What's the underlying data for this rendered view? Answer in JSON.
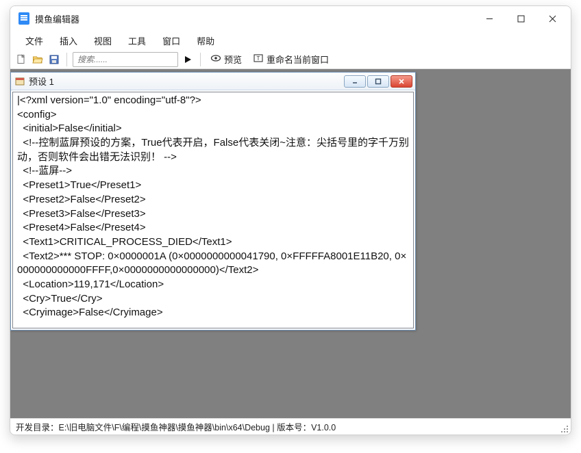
{
  "window": {
    "title": "摸鱼编辑器"
  },
  "menu": {
    "file": "文件",
    "insert": "插入",
    "view": "视图",
    "tools": "工具",
    "window": "窗口",
    "help": "帮助"
  },
  "toolbar": {
    "search_placeholder": "搜索......",
    "preview": "预览",
    "rename": "重命名当前窗口"
  },
  "child": {
    "title": "预设 1",
    "content": "|<?xml version=\"1.0\" encoding=\"utf-8\"?>\n<config>\n  <initial>False</initial>\n  <!--控制蓝屏预设的方案，True代表开启，False代表关闭~注意：尖括号里的字千万别动，否则软件会出错无法识别！ -->\n  <!--蓝屏-->\n  <Preset1>True</Preset1>\n  <Preset2>False</Preset2>\n  <Preset3>False</Preset3>\n  <Preset4>False</Preset4>\n  <Text1>CRITICAL_PROCESS_DIED</Text1>\n  <Text2>*** STOP: 0×0000001A (0×0000000000041790, 0×FFFFFA8001E11B20, 0×000000000000FFFF,0×0000000000000000)</Text2>\n  <Location>119,171</Location>\n  <Cry>True</Cry>\n  <Cryimage>False</Cryimage>"
  },
  "statusbar": {
    "text": "开发目录：E:\\旧电脑文件\\F\\编程\\摸鱼神器\\摸鱼神器\\bin\\x64\\Debug | 版本号：V1.0.0"
  }
}
